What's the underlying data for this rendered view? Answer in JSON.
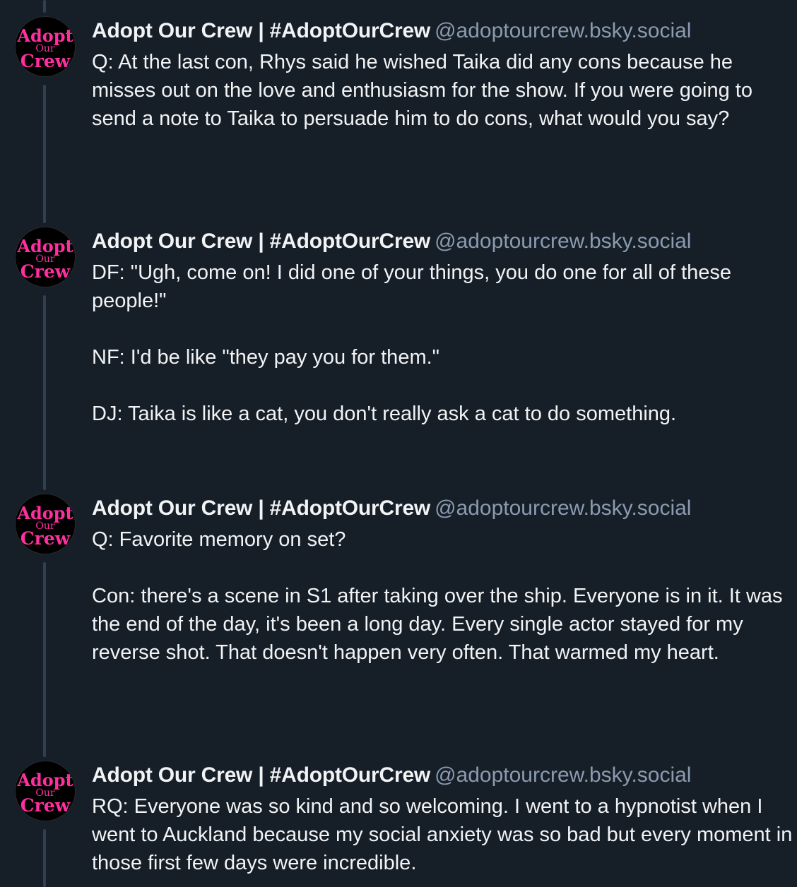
{
  "author": {
    "display_name": "Adopt Our Crew | #AdoptOurCrew",
    "handle": "@adoptourcrew.bsky.social",
    "avatar_text": [
      "Adopt",
      "Our",
      "Crew"
    ],
    "avatar_color": "#ff2fa0"
  },
  "posts": [
    {
      "paragraphs": [
        "Q: At the last con, Rhys said he wished Taika did any cons because he misses out on the love and enthusiasm for the show. If you were going to send a note to Taika to persuade him to do cons, what would you say?"
      ]
    },
    {
      "paragraphs": [
        "DF: \"Ugh, come on! I did one of your things, you do one for all of these people!\"",
        "NF: I'd be like \"they pay you for them.\"",
        "DJ: Taika is like a cat, you don't really ask a cat to do something."
      ]
    },
    {
      "paragraphs": [
        "Q: Favorite memory on set?",
        "Con: there's a scene in S1 after taking over the ship. Everyone is in it. It was the end of the day, it's been a long day. Every single actor stayed for my reverse shot. That doesn't happen very often. That warmed my heart."
      ]
    },
    {
      "paragraphs": [
        "RQ: Everyone was so kind and so welcoming. I went to a hypnotist when I went to Auckland because my social anxiety was so bad but every moment in those first few days were incredible."
      ]
    }
  ],
  "colors": {
    "background": "#161e27",
    "text": "#f1f3f5",
    "handle": "#8a9bb0",
    "thread_line": "#2e4052"
  }
}
